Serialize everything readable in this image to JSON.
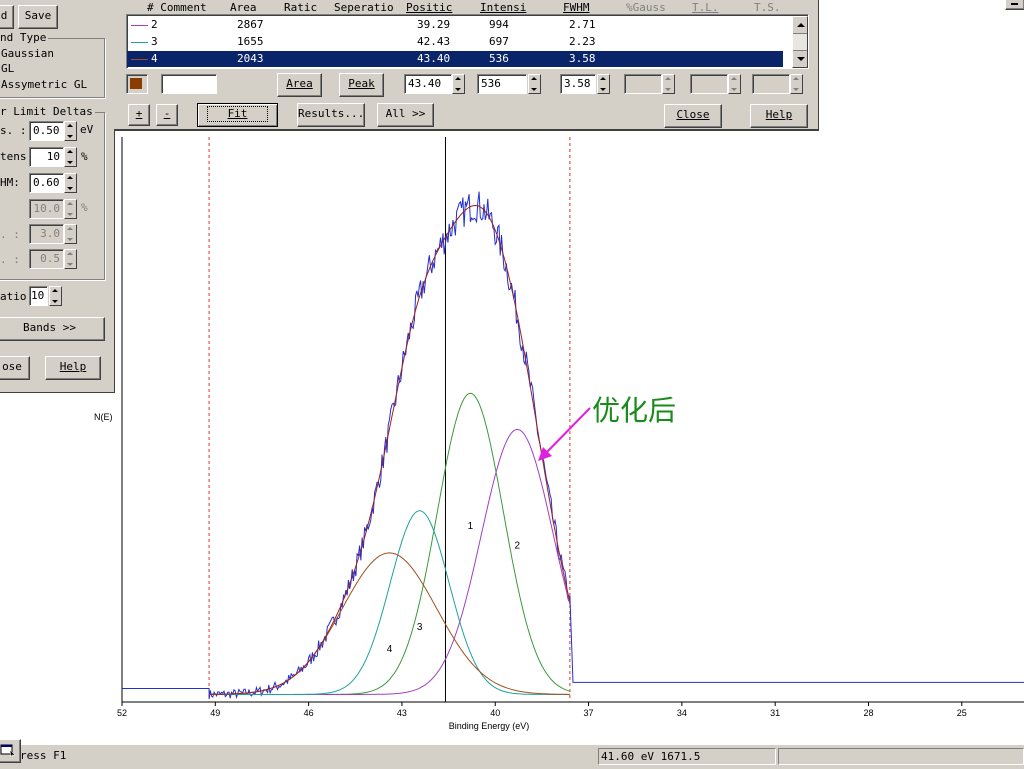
{
  "left_panel": {
    "top_buttons": [
      "d",
      "Save"
    ],
    "band_type_title": "nd Type",
    "band_type_options": [
      "Gaussian",
      "GL",
      "Assymetric GL"
    ],
    "limit_title": "r Limit Deltas",
    "limit_rows": [
      {
        "label": "s. :",
        "value": "0.50",
        "unit": "eV",
        "enabled": true
      },
      {
        "label": "tens",
        "value": "10",
        "unit": "%",
        "enabled": true
      },
      {
        "label": "HM:",
        "value": "0.60",
        "unit": "",
        "enabled": true
      },
      {
        "label": "",
        "value": "10.0",
        "unit": "%",
        "enabled": false
      },
      {
        "label": ". :",
        "value": "3.0",
        "unit": "",
        "enabled": false
      },
      {
        "label": ". :",
        "value": "0.5",
        "unit": "",
        "enabled": false
      }
    ],
    "ratio_label": "atio",
    "ratio_value": "10",
    "bands_button": "Bands >>",
    "close_button": "ose",
    "help_button": "Help"
  },
  "band_table": {
    "headers": [
      "# Comment",
      "Area",
      "Ratic",
      "Seperatio",
      "Positic",
      "Intensi",
      "FWHM",
      "%Gauss",
      "T.L.",
      "T.S."
    ],
    "rows": [
      {
        "num": "2",
        "area": "2867",
        "position": "39.29",
        "intensity": "994",
        "fwhm": "2.71",
        "color": "#a040c0",
        "selected": false
      },
      {
        "num": "3",
        "area": "1655",
        "position": "42.43",
        "intensity": "697",
        "fwhm": "2.23",
        "color": "#20a0a0",
        "selected": false
      },
      {
        "num": "4",
        "area": "2043",
        "position": "43.40",
        "intensity": "536",
        "fwhm": "3.58",
        "color": "#a05020",
        "selected": true
      }
    ],
    "swatch_color": "#8b3c00",
    "area_button": "Area",
    "peak_button": "Peak",
    "edit_position": "43.40",
    "edit_intensity": "536",
    "edit_fwhm": "3.58",
    "plus_button": "+",
    "minus_button": "-",
    "fit_button": "Fit",
    "results_button": "Results...",
    "all_button": "All >>",
    "close_button": "Close",
    "help_button": "Help"
  },
  "chart_data": {
    "type": "line",
    "xlabel": "Binding Energy (eV)",
    "ylabel": "N(E)",
    "x_reversed": true,
    "xlim": [
      52,
      23
    ],
    "x_ticks": [
      52,
      49,
      46,
      43,
      40,
      37,
      34,
      31,
      28,
      25
    ],
    "ylim": [
      0,
      1700
    ],
    "fit_window_ev": [
      49.2,
      37.6
    ],
    "cursor_ev": 41.6,
    "baseline": 25,
    "peaks": [
      {
        "label": "1",
        "center": 40.8,
        "height": 1000,
        "fwhm": 2.5,
        "color": "#3a9a3a"
      },
      {
        "label": "2",
        "center": 39.29,
        "height": 880,
        "fwhm": 2.71,
        "color": "#a040c0"
      },
      {
        "label": "3",
        "center": 42.43,
        "height": 610,
        "fwhm": 2.23,
        "color": "#20a0a0"
      },
      {
        "label": "4",
        "center": 43.4,
        "height": 470,
        "fwhm": 3.58,
        "color": "#a05020"
      }
    ],
    "raw_color": "#2030d0",
    "envelope_color": "#a02020",
    "annotation_text": "优化后",
    "annotation_color": "#1a8a1a",
    "arrow_color": "#e020e0"
  },
  "status_bar": {
    "hint": "ress F1",
    "coords": "41.60 eV  1671.5"
  }
}
